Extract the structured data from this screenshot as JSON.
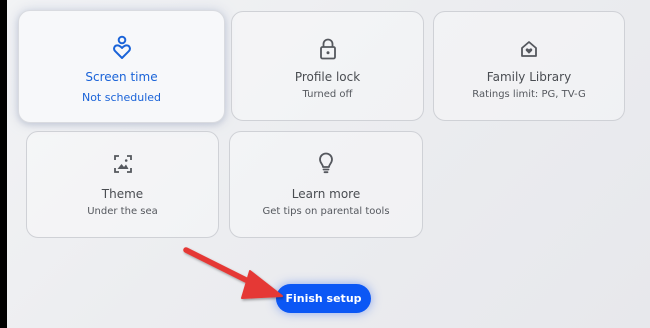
{
  "cards": [
    {
      "title": "Screen time",
      "subtitle": "Not scheduled",
      "icon": "screen-time-icon",
      "focused": true
    },
    {
      "title": "Profile lock",
      "subtitle": "Turned off",
      "icon": "lock-icon",
      "focused": false
    },
    {
      "title": "Family Library",
      "subtitle": "Ratings limit: PG, TV-G",
      "icon": "family-library-icon",
      "focused": false
    },
    {
      "title": "Theme",
      "subtitle": "Under the sea",
      "icon": "theme-icon",
      "focused": false
    },
    {
      "title": "Learn more",
      "subtitle": "Get tips on parental tools",
      "icon": "lightbulb-icon",
      "focused": false
    }
  ],
  "finish_button": {
    "label": "Finish setup"
  },
  "colors": {
    "accent": "#1a63d8",
    "button": "#0b57f5",
    "annotation_arrow": "#e53935"
  }
}
